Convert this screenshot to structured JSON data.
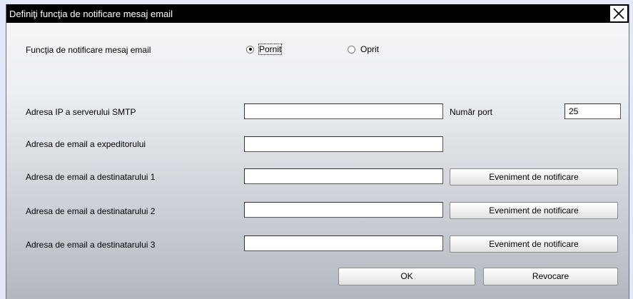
{
  "dialog": {
    "title": "Definiţi funcţia de notificare mesaj email",
    "close_icon": "close-icon"
  },
  "notification": {
    "label": "Funcţia de notificare mesaj email",
    "on_label": "Pornit",
    "off_label": "Oprit",
    "selected": "Pornit"
  },
  "smtp": {
    "label": "Adresa IP a serverului SMTP",
    "value": "",
    "port_label": "Număr port",
    "port_value": "25"
  },
  "sender": {
    "label": "Adresa de email a expeditorului",
    "value": ""
  },
  "recipients": [
    {
      "label": "Adresa de email a destinatarului 1",
      "value": "",
      "button": "Eveniment de notificare"
    },
    {
      "label": "Adresa de email a destinatarului 2",
      "value": "",
      "button": "Eveniment de notificare"
    },
    {
      "label": "Adresa de email a destinatarului 3",
      "value": "",
      "button": "Eveniment de notificare"
    }
  ],
  "footer": {
    "ok_label": "OK",
    "cancel_label": "Revocare"
  }
}
